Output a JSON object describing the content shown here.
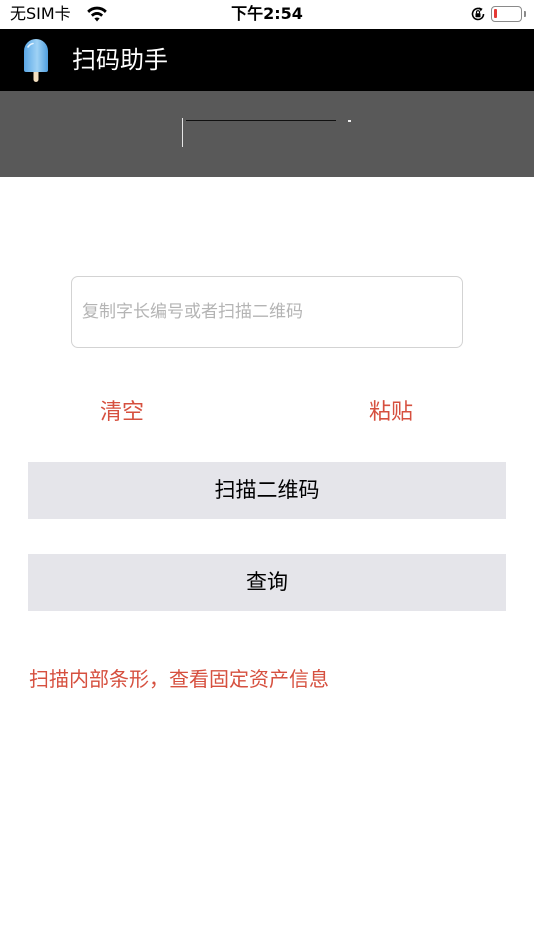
{
  "status_bar": {
    "carrier": "无SIM卡",
    "time": "下午2:54",
    "icons": [
      "wifi-icon",
      "rotation-lock-icon",
      "battery-icon"
    ],
    "battery_color": "#e53935"
  },
  "nav": {
    "title": "扫码助手",
    "app_icon": "popsicle-icon",
    "background": "#000000"
  },
  "form": {
    "input_value": "",
    "input_placeholder": "复制字长编号或者扫描二维码",
    "clear_label": "清空",
    "paste_label": "粘贴",
    "scan_label": "扫描二维码",
    "query_label": "查询",
    "hint": "扫描内部条形，查看固定资产信息"
  },
  "colors": {
    "accent_red": "#d6503f",
    "button_gray": "#e5e5ea",
    "banner_gray": "#595959"
  }
}
